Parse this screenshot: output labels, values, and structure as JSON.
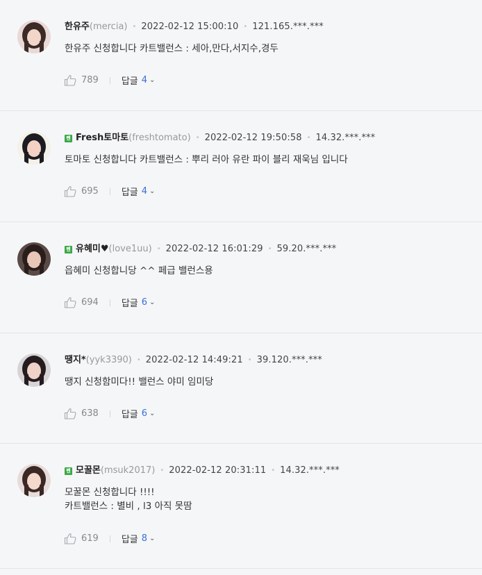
{
  "comments": [
    {
      "nickname": "한유주",
      "user_id": "(mercia)",
      "has_badge": false,
      "datetime": "2022-02-12 15:00:10",
      "ip": "121.165.***.***",
      "text": "한유주 신청합니다 카트밸런스 : 세아,만다,서지수,경두",
      "likes": "789",
      "reply_label": "답글",
      "reply_count": "4",
      "avatar_colors": [
        "#e9d9d6",
        "#3b2a26",
        "#f2d6c9"
      ]
    },
    {
      "nickname": "Fresh토마토",
      "user_id": "(freshtomato)",
      "has_badge": true,
      "datetime": "2022-02-12 19:50:58",
      "ip": "14.32.***.***",
      "text": "토마토 신청합니다 카트밸런스 : 뿌리 러아 유란 파이 블리 재욱님 입니다",
      "likes": "695",
      "reply_label": "답글",
      "reply_count": "4",
      "avatar_colors": [
        "#f4f1e8",
        "#1c1c22",
        "#f3d2c4"
      ]
    },
    {
      "nickname": "유혜미♥",
      "user_id": "(love1uu)",
      "has_badge": true,
      "datetime": "2022-02-12 16:01:29",
      "ip": "59.20.***.***",
      "text": "읍혜미 신청합니당 ^^ 페급 밸런스용",
      "likes": "694",
      "reply_label": "답글",
      "reply_count": "6",
      "avatar_colors": [
        "#5a4a48",
        "#2a1e1c",
        "#e8c6b8"
      ]
    },
    {
      "nickname": "땡지*",
      "user_id": "(yyk3390)",
      "has_badge": false,
      "datetime": "2022-02-12 14:49:21",
      "ip": "39.120.***.***",
      "text": "땡지 신청함미다!! 밸런스 야미 임미당",
      "likes": "638",
      "reply_label": "답글",
      "reply_count": "6",
      "avatar_colors": [
        "#d8d4d6",
        "#241c1e",
        "#f0d2c8"
      ]
    },
    {
      "nickname": "모꿀몬",
      "user_id": "(msuk2017)",
      "has_badge": true,
      "datetime": "2022-02-12 20:31:11",
      "ip": "14.32.***.***",
      "text": "모꿀몬 신청합니다 !!!!\n카트밸런스 : 별비 , l3 아직 못땀",
      "likes": "619",
      "reply_label": "답글",
      "reply_count": "8",
      "avatar_colors": [
        "#e7dcda",
        "#3a2824",
        "#f4d8cc"
      ]
    }
  ],
  "badge_text": "펜",
  "colors": {
    "background": "#f5f6f8",
    "divider": "#e3e4e8",
    "reply_count": "#3a6fd8",
    "badge": "#3aa845"
  }
}
